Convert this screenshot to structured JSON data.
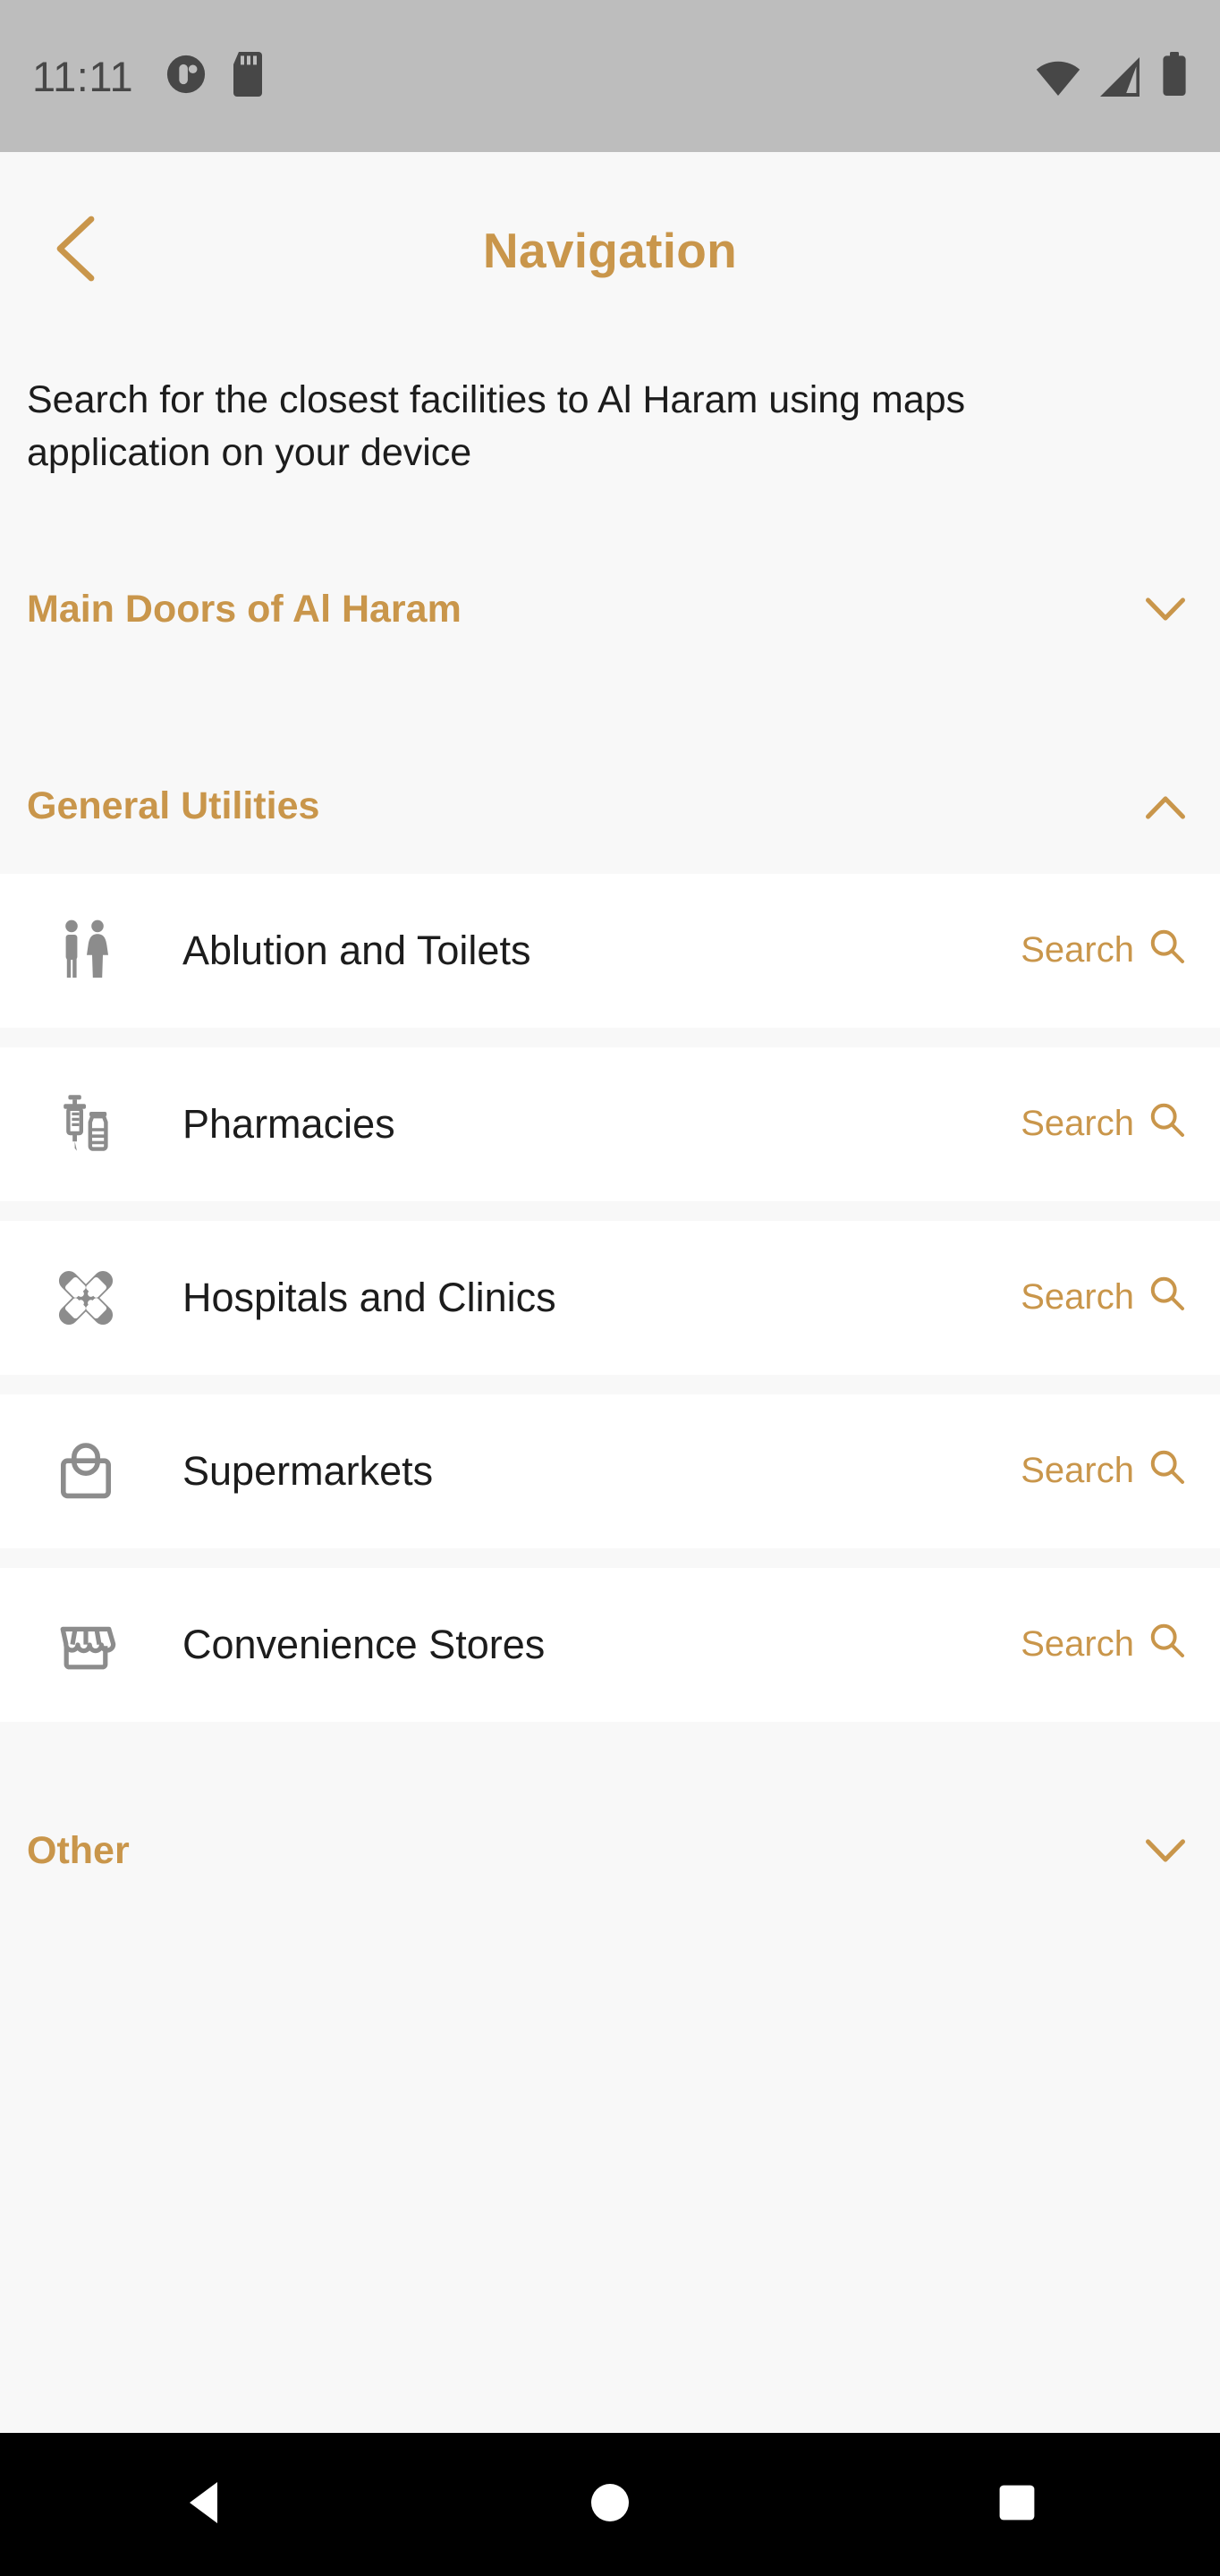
{
  "status_bar": {
    "time": "11:11",
    "left_icons": [
      "do-not-disturb-icon",
      "sd-card-icon"
    ],
    "right_icons": [
      "wifi-icon",
      "cellular-signal-icon",
      "battery-icon"
    ]
  },
  "header": {
    "back_icon": "chevron-left-icon",
    "title": "Navigation",
    "accent_color": "#C9964B"
  },
  "description": "Search for the closest facilities to Al Haram using maps application on your device",
  "sections": [
    {
      "title": "Main Doors of Al Haram",
      "expanded": false,
      "chevron": "chevron-down-icon",
      "items": []
    },
    {
      "title": "General Utilities",
      "expanded": true,
      "chevron": "chevron-up-icon",
      "items": [
        {
          "label": "Ablution and Toilets",
          "icon": "restroom-icon",
          "action": "Search",
          "action_icon": "search-icon"
        },
        {
          "label": "Pharmacies",
          "icon": "syringe-vial-icon",
          "action": "Search",
          "action_icon": "search-icon"
        },
        {
          "label": "Hospitals and Clinics",
          "icon": "bandage-cross-icon",
          "action": "Search",
          "action_icon": "search-icon"
        },
        {
          "label": "Supermarkets",
          "icon": "shopping-bag-icon",
          "action": "Search",
          "action_icon": "search-icon"
        },
        {
          "label": "Convenience Stores",
          "icon": "storefront-icon",
          "action": "Search",
          "action_icon": "search-icon"
        }
      ]
    },
    {
      "title": "Other",
      "expanded": false,
      "chevron": "chevron-down-icon",
      "items": []
    }
  ],
  "nav_bar": {
    "back": "back-triangle-icon",
    "home": "home-circle-icon",
    "recents": "recents-square-icon"
  },
  "colors": {
    "accent": "#C9964B",
    "page_bg": "#F8F8F8",
    "card_bg": "#FFFFFF",
    "status_bar_bg": "#BDBDBD",
    "icon_gray": "#8C8C8C",
    "text": "#1C1C1C"
  }
}
